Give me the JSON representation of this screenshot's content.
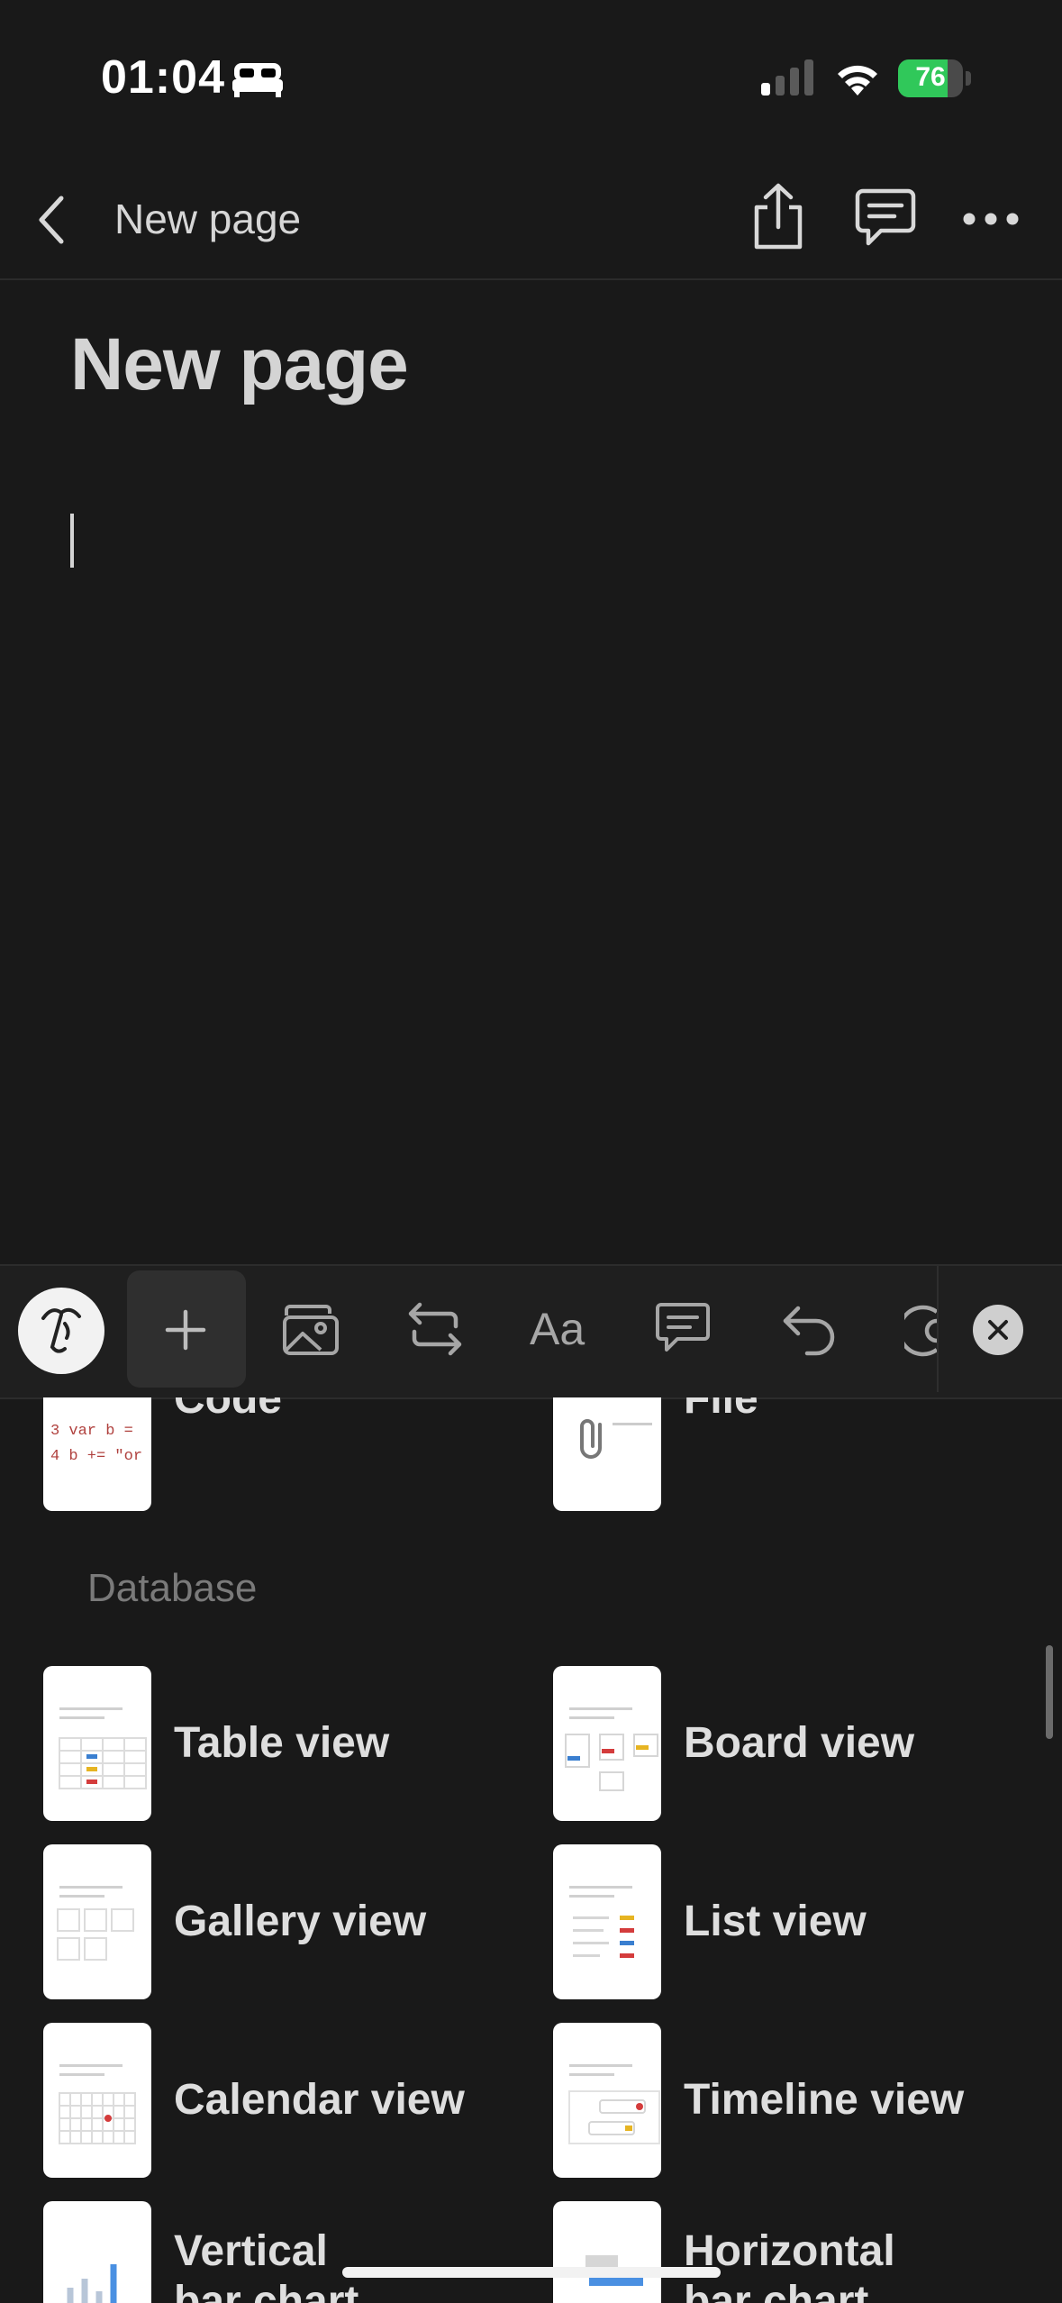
{
  "status_bar": {
    "time": "01:04",
    "battery": "76",
    "battery_level": 0.76,
    "icons": [
      "bed-icon",
      "signal-icon",
      "wifi-icon",
      "battery-charging-icon"
    ]
  },
  "nav": {
    "back_icon": "chevron-left-icon",
    "title": "New page",
    "actions": [
      "share-icon",
      "comment-icon",
      "more-icon"
    ]
  },
  "page": {
    "title": "New page"
  },
  "toolbar": {
    "items": [
      "ai-assistant-icon",
      "plus-icon",
      "image-icon",
      "turn-into-icon",
      "text-style-icon",
      "comment-icon",
      "undo-icon",
      "mention-icon",
      "close-icon"
    ]
  },
  "blocks": {
    "partial_row": [
      {
        "label": "Code",
        "icon": "code-preview"
      },
      {
        "label": "File",
        "icon": "file-preview"
      }
    ],
    "section_title": "Database",
    "items": [
      {
        "label": "Table view",
        "icon": "table-view-preview"
      },
      {
        "label": "Board view",
        "icon": "board-view-preview"
      },
      {
        "label": "Gallery view",
        "icon": "gallery-view-preview"
      },
      {
        "label": "List view",
        "icon": "list-view-preview"
      },
      {
        "label": "Calendar view",
        "icon": "calendar-view-preview"
      },
      {
        "label": "Timeline view",
        "icon": "timeline-view-preview"
      },
      {
        "label": "Vertical bar chart",
        "icon": "vertical-bar-chart-preview"
      },
      {
        "label": "Horizontal bar chart",
        "icon": "horizontal-bar-chart-preview"
      }
    ],
    "code_snippet": [
      "3 var b =",
      "4 b += \"or"
    ]
  },
  "colors": {
    "background": "#191919",
    "toolbar": "#1f1f1f",
    "battery_green": "#30c85a"
  }
}
